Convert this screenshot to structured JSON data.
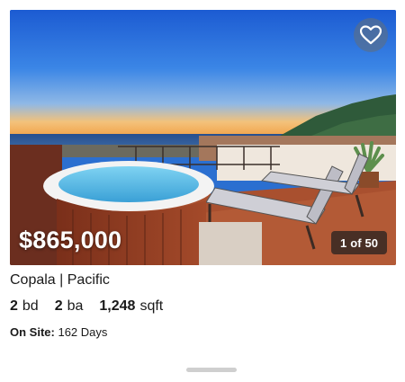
{
  "listing": {
    "price": "$865,000",
    "photo_index": "1",
    "photo_of_label": "of",
    "photo_total": "50",
    "title": "Copala | Pacific",
    "beds_value": "2",
    "beds_unit": "bd",
    "baths_value": "2",
    "baths_unit": "ba",
    "sqft_value": "1,248",
    "sqft_unit": "sqft",
    "on_site_label": "On Site:",
    "on_site_value": "162 Days"
  },
  "icons": {
    "favorite": "heart-icon"
  },
  "colors": {
    "sky_top": "#1f5fd3",
    "horizon": "#f4a23a",
    "ocean": "#1b3f7a",
    "badge_bg": "#2a2a2a"
  }
}
